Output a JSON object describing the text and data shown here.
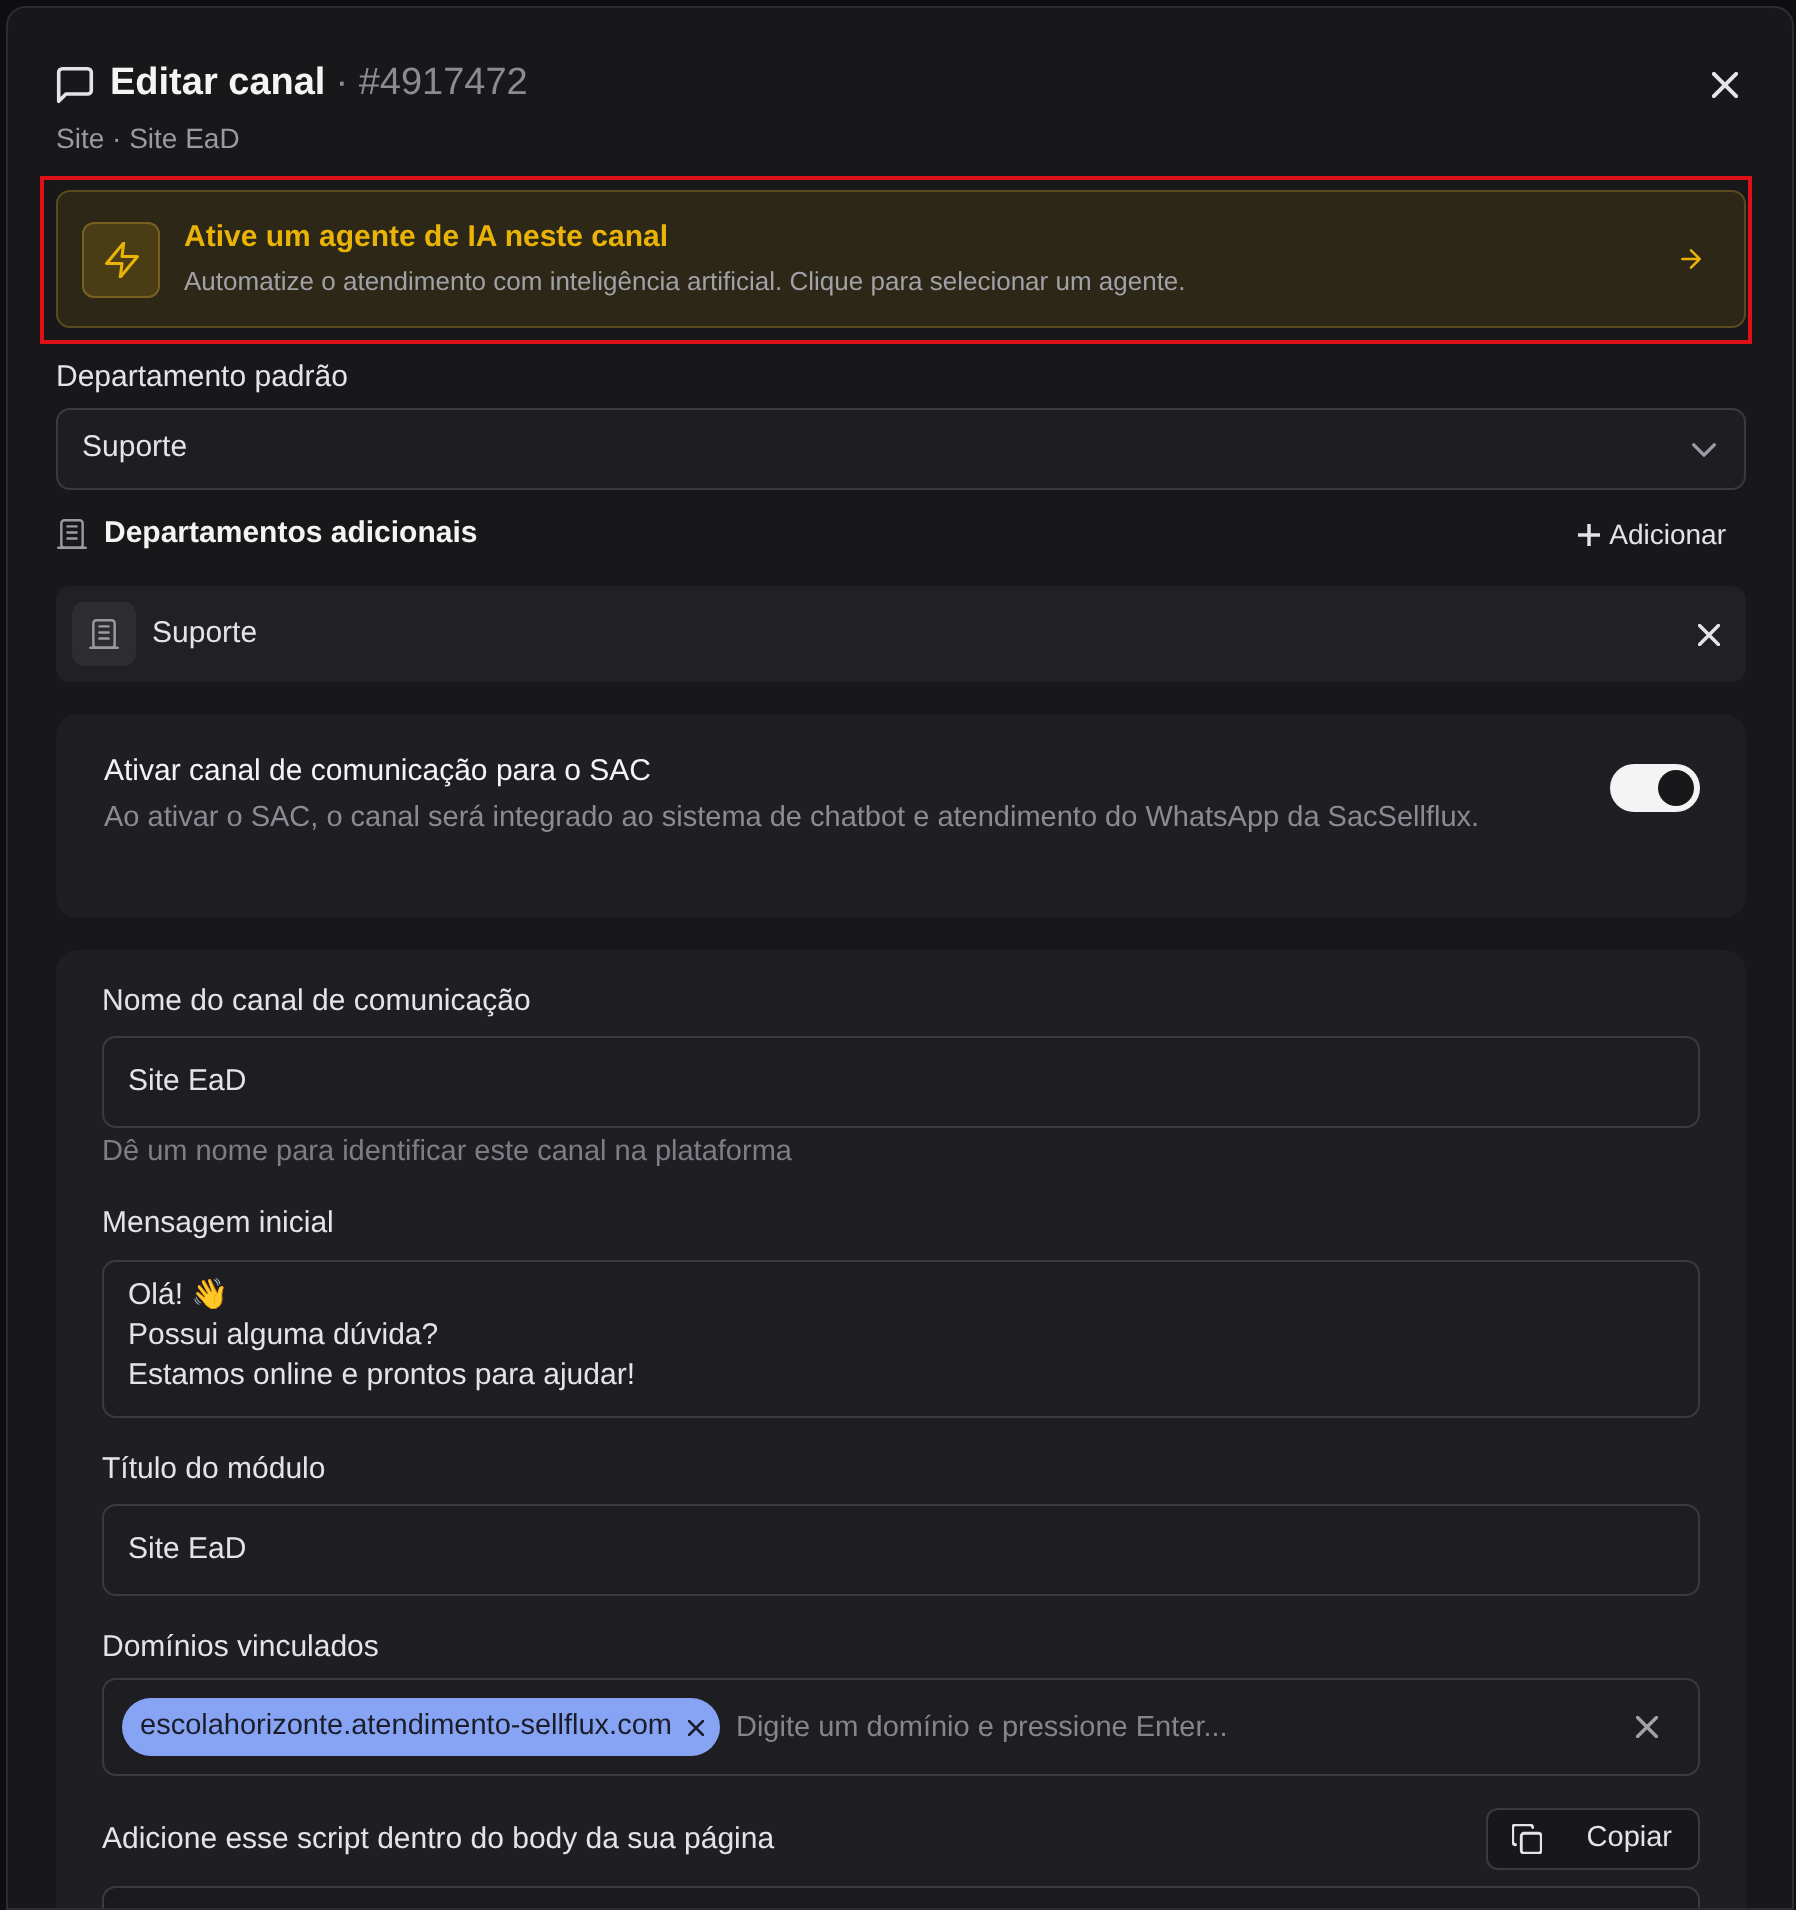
{
  "dialog": {
    "title": "Editar canal",
    "channel_id": "· #4917472",
    "subtitle": "Site · Site EaD"
  },
  "ai_banner": {
    "highlighted": true,
    "title": "Ative um agente de IA neste canal",
    "description": "Automatize o atendimento com inteligência artificial. Clique para selecionar um agente."
  },
  "default_department": {
    "label": "Departamento padrão",
    "value": "Suporte"
  },
  "additional_departments": {
    "title": "Departamentos adicionais",
    "add_label": "Adicionar",
    "items": [
      {
        "name": "Suporte"
      }
    ]
  },
  "sac": {
    "title": "Ativar canal de comunicação para o SAC",
    "description": "Ao ativar o SAC, o canal será integrado ao sistema de chatbot e atendimento do WhatsApp da SacSellflux.",
    "on": true
  },
  "form": {
    "fields": [
      {
        "kind": "input",
        "label": "Nome do canal de comunicação",
        "value": "Site EaD",
        "help": "Dê um nome para identificar este canal na plataforma"
      },
      {
        "kind": "textarea",
        "label": "Mensagem inicial",
        "value": "Olá! 👋\nPossui alguma dúvida?\nEstamos online e prontos para ajudar!"
      },
      {
        "kind": "input",
        "label": "Título do módulo",
        "value": "Site EaD"
      },
      {
        "kind": "tags",
        "label": "Domínios vinculados",
        "tags": [
          "escolahorizonte.atendimento-sellflux.com"
        ],
        "placeholder": "Digite um domínio e pressione Enter..."
      },
      {
        "kind": "script",
        "label": "Adicione esse script dentro do body da sua página",
        "copy_label": "Copiar"
      }
    ]
  }
}
